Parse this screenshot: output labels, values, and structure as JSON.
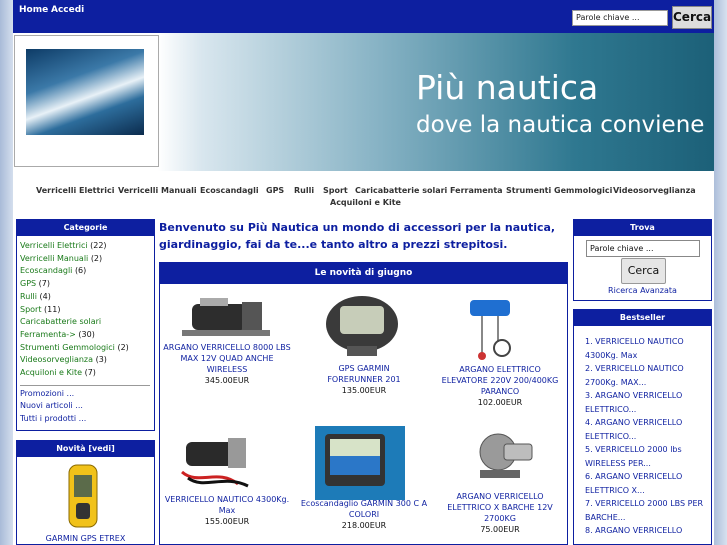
{
  "topnav": {
    "home": "Home",
    "login": "Accedi"
  },
  "search": {
    "placeholder": "Parole chiave ...",
    "button": "Cerca"
  },
  "header": {
    "title": "Più nautica",
    "subtitle": "dove la nautica conviene"
  },
  "categories_nav": [
    "Verricelli Elettrici",
    "Verricelli Manuali",
    "Ecoscandagli",
    "GPS",
    "Rulli",
    "Sport",
    "Caricabatterie solari",
    "Ferramenta",
    "Strumenti Gemmologici",
    "Videosorveglianza",
    "Acquiloni e Kite"
  ],
  "sidebar": {
    "categories_title": "Categorie",
    "categories": [
      {
        "name": "Verricelli Elettrici",
        "count": "(22)"
      },
      {
        "name": "Verricelli Manuali",
        "count": "(2)"
      },
      {
        "name": "Ecoscandagli",
        "count": "(6)"
      },
      {
        "name": "GPS",
        "count": "(7)"
      },
      {
        "name": "Rulli",
        "count": "(4)"
      },
      {
        "name": "Sport",
        "count": "(11)"
      },
      {
        "name": "Caricabatterie solari",
        "count": ""
      },
      {
        "name": "Ferramenta->",
        "count": "(30)"
      },
      {
        "name": "Strumenti Gemmologici",
        "count": "(2)"
      },
      {
        "name": "Videosorveglianza",
        "count": "(3)"
      },
      {
        "name": "Acquiloni e Kite",
        "count": "(7)"
      }
    ],
    "links": [
      "Promozioni ...",
      "Nuovi articoli ...",
      "Tutti i prodotti ..."
    ],
    "new_title": "Novità  [vedi]",
    "new_item": "GARMIN GPS ETREX"
  },
  "main": {
    "welcome": "Benvenuto su Più Nautica un mondo di accessori per la nautica, giardinaggio, fai da te...e tanto altro a prezzi strepitosi.",
    "news_title": "Le novità di giugno",
    "products": [
      {
        "name": "ARGANO VERRICELLO 8000 LBS MAX 12V QUAD ANCHE WIRELESS",
        "price": "345.00EUR"
      },
      {
        "name": "GPS GARMIN FORERUNNER 201",
        "price": "135.00EUR"
      },
      {
        "name": "ARGANO ELETTRICO ELEVATORE 220V 200/400KG PARANCO",
        "price": "102.00EUR"
      },
      {
        "name": "VERRICELLO NAUTICO 4300Kg. Max",
        "price": "155.00EUR"
      },
      {
        "name": "Ecoscandaglio GARMIN 300 C A COLORI",
        "price": "218.00EUR"
      },
      {
        "name": "ARGANO VERRICELLO ELETTRICO X BARCHE 12V 2700KG",
        "price": "75.00EUR"
      }
    ]
  },
  "right": {
    "find_title": "Trova",
    "find_placeholder": "Parole chiave ...",
    "find_button": "Cerca",
    "advanced": "Ricerca Avanzata",
    "bestseller_title": "Bestseller",
    "bestsellers": [
      "1. VERRICELLO NAUTICO 4300Kg. Max",
      "2. VERRICELLO NAUTICO 2700Kg. MAX...",
      "3. ARGANO VERRICELLO ELETTRICO...",
      "4. ARGANO VERRICELLO ELETTRICO...",
      "5. VERRICELLO 2000 lbs WIRELESS PER...",
      "6. ARGANO VERRICELLO ELETTRICO X...",
      "7. VERRICELLO 2000 LBS PER BARCHE...",
      "8. ARGANO VERRICELLO"
    ]
  }
}
